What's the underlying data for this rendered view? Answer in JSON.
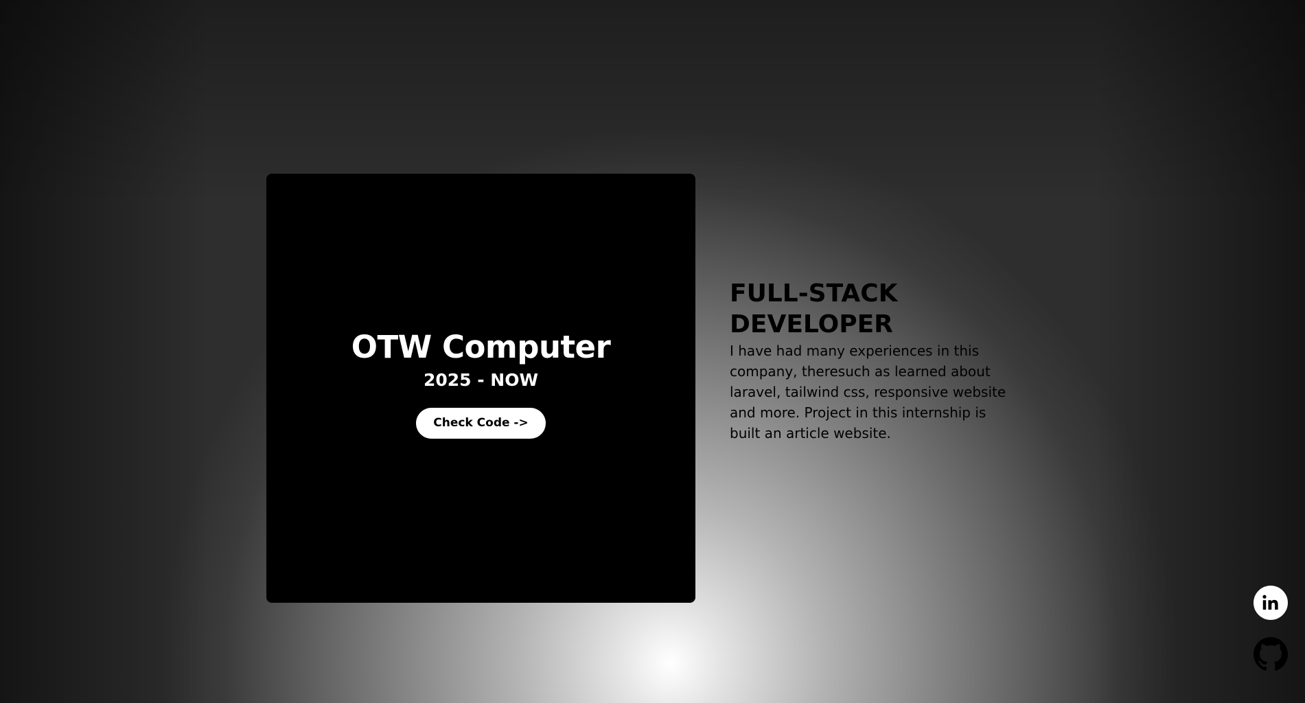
{
  "experience": {
    "company": "OTW Computer",
    "period": "2025 - NOW",
    "button_label": "Check Code ->"
  },
  "role": {
    "heading": "FULL-STACK DEVELOPER",
    "description": "I have had many experiences in this company, theresuch as learned about laravel, tailwind css, responsive website and more. Project in this internship is built an article website."
  },
  "social": {
    "icons": [
      "linkedin-icon",
      "github-icon"
    ]
  },
  "colors": {
    "card_background": "#000000",
    "text_dark": "#000000",
    "text_light": "#ffffff",
    "button_background": "#ffffff"
  }
}
